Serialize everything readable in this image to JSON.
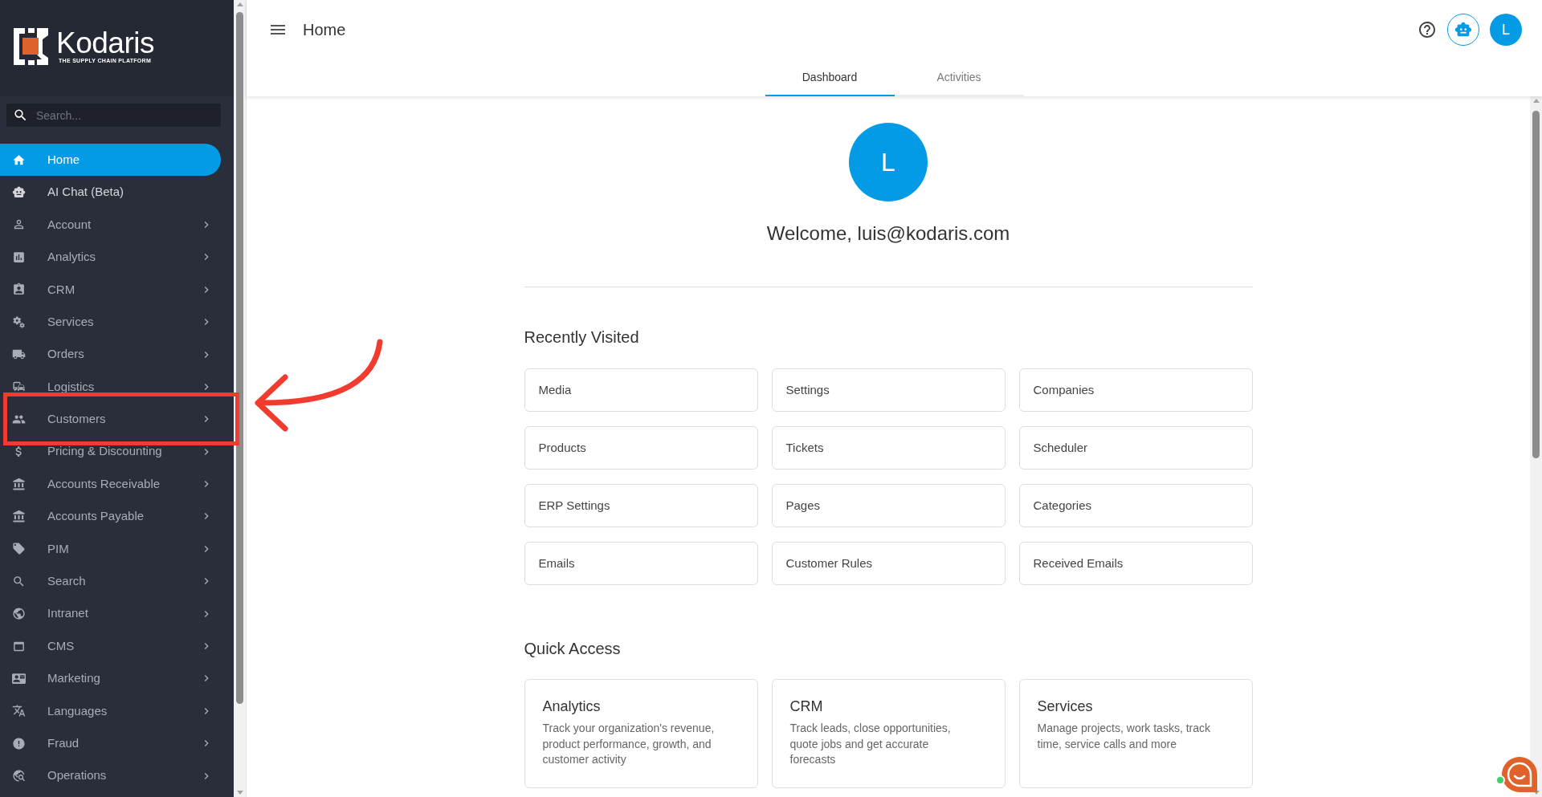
{
  "sidebar": {
    "logo": {
      "wordmark": "Kodaris",
      "tagline": "THE SUPPLY CHAIN PLATFORM"
    },
    "search": {
      "placeholder": "Search..."
    },
    "items": [
      {
        "label": "Home",
        "selected": true,
        "expandable": false,
        "highlighted": false
      },
      {
        "label": "AI Chat (Beta)",
        "selected": false,
        "expandable": false,
        "highlighted": false
      },
      {
        "label": "Account",
        "selected": false,
        "expandable": true,
        "highlighted": false
      },
      {
        "label": "Analytics",
        "selected": false,
        "expandable": true,
        "highlighted": false
      },
      {
        "label": "CRM",
        "selected": false,
        "expandable": true,
        "highlighted": false
      },
      {
        "label": "Services",
        "selected": false,
        "expandable": true,
        "highlighted": false
      },
      {
        "label": "Orders",
        "selected": false,
        "expandable": true,
        "highlighted": false
      },
      {
        "label": "Logistics",
        "selected": false,
        "expandable": true,
        "highlighted": false
      },
      {
        "label": "Customers",
        "selected": false,
        "expandable": true,
        "highlighted": true
      },
      {
        "label": "Pricing & Discounting",
        "selected": false,
        "expandable": true,
        "highlighted": false
      },
      {
        "label": "Accounts Receivable",
        "selected": false,
        "expandable": true,
        "highlighted": false
      },
      {
        "label": "Accounts Payable",
        "selected": false,
        "expandable": true,
        "highlighted": false
      },
      {
        "label": "PIM",
        "selected": false,
        "expandable": true,
        "highlighted": false
      },
      {
        "label": "Search",
        "selected": false,
        "expandable": true,
        "highlighted": false
      },
      {
        "label": "Intranet",
        "selected": false,
        "expandable": true,
        "highlighted": false
      },
      {
        "label": "CMS",
        "selected": false,
        "expandable": true,
        "highlighted": false
      },
      {
        "label": "Marketing",
        "selected": false,
        "expandable": true,
        "highlighted": false
      },
      {
        "label": "Languages",
        "selected": false,
        "expandable": true,
        "highlighted": false
      },
      {
        "label": "Fraud",
        "selected": false,
        "expandable": true,
        "highlighted": false
      },
      {
        "label": "Operations",
        "selected": false,
        "expandable": true,
        "highlighted": false
      }
    ]
  },
  "header": {
    "title": "Home",
    "avatar_initial": "L"
  },
  "tabs": [
    {
      "label": "Dashboard",
      "selected": true
    },
    {
      "label": "Activities",
      "selected": false
    }
  ],
  "welcome": {
    "avatar_initial": "L",
    "text": "Welcome, luis@kodaris.com"
  },
  "recently_visited": {
    "title": "Recently Visited",
    "items": [
      "Media",
      "Settings",
      "Companies",
      "Products",
      "Tickets",
      "Scheduler",
      "ERP Settings",
      "Pages",
      "Categories",
      "Emails",
      "Customer Rules",
      "Received Emails"
    ]
  },
  "quick_access": {
    "title": "Quick Access",
    "cards": [
      {
        "title": "Analytics",
        "description": "Track your organization's revenue, product performance, growth, and customer activity"
      },
      {
        "title": "CRM",
        "description": "Track leads, close opportunities, quote jobs and get accurate forecasts"
      },
      {
        "title": "Services",
        "description": "Manage projects, work tasks, track time, service calls and more"
      }
    ]
  }
}
